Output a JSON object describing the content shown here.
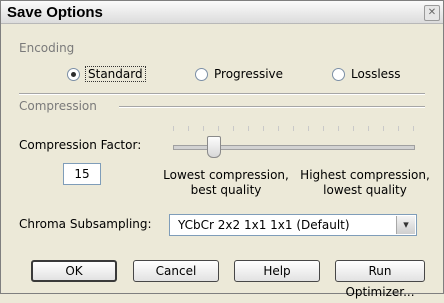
{
  "dialog": {
    "title": "Save Options",
    "close_glyph": "✕"
  },
  "encoding": {
    "section_label": "Encoding",
    "options": [
      {
        "label": "Standard",
        "selected": true
      },
      {
        "label": "Progressive",
        "selected": false
      },
      {
        "label": "Lossless",
        "selected": false
      }
    ]
  },
  "compression": {
    "section_label": "Compression",
    "factor_label": "Compression Factor:",
    "factor_value": "15",
    "slider_fraction": 0.15,
    "low_desc_line1": "Lowest compression,",
    "low_desc_line2": "best quality",
    "high_desc_line1": "Highest compression,",
    "high_desc_line2": "lowest quality"
  },
  "chroma": {
    "label": "Chroma Subsampling:",
    "selected": "YCbCr  2x2  1x1  1x1  (Default)",
    "arrow_glyph": "▾"
  },
  "buttons": {
    "ok": "OK",
    "cancel": "Cancel",
    "help": "Help",
    "run_optimizer": "Run Optimizer..."
  }
}
